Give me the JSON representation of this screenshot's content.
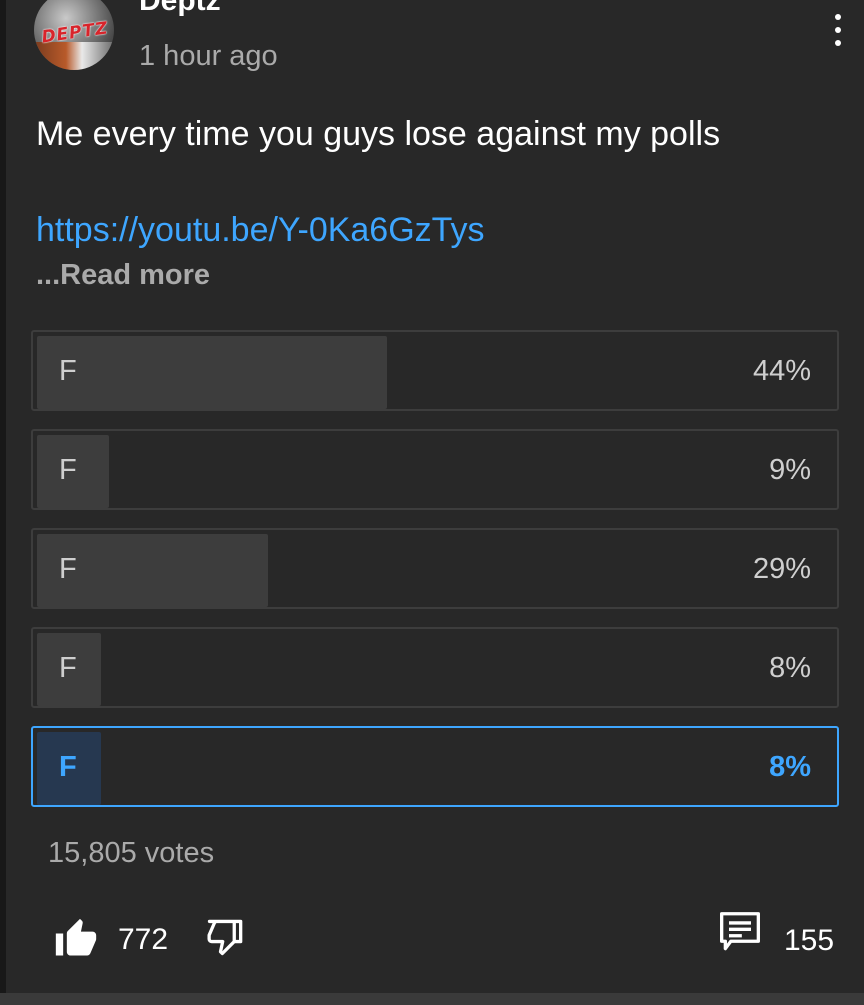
{
  "post": {
    "channel_name": "Deptz",
    "avatar_text": "DEPTZ",
    "timestamp": "1 hour ago",
    "menu_icon": "more-vert-icon",
    "text": "Me every time you guys lose against my polls",
    "link": "https://youtu.be/Y-0Ka6GzTys",
    "read_more": "...Read more"
  },
  "poll": {
    "options": [
      {
        "label": "F",
        "percent_label": "44%",
        "share": 0.44,
        "selected": false
      },
      {
        "label": "F",
        "percent_label": "9%",
        "share": 0.09,
        "selected": false
      },
      {
        "label": "F",
        "percent_label": "29%",
        "share": 0.29,
        "selected": false
      },
      {
        "label": "F",
        "percent_label": "8%",
        "share": 0.08,
        "selected": false
      },
      {
        "label": "F",
        "percent_label": "8%",
        "share": 0.08,
        "selected": true
      }
    ],
    "votes": "15,805 votes"
  },
  "actions": {
    "like_icon": "thumbs-up-icon",
    "like_count": "772",
    "dislike_icon": "thumbs-down-icon",
    "comment_icon": "comment-icon",
    "comment_count": "155"
  },
  "colors": {
    "background": "#282828",
    "accent": "#3ea6ff",
    "muted_text": "#aaaaaa",
    "poll_fill": "#3d3d3d",
    "selected_fill": "#263850"
  }
}
